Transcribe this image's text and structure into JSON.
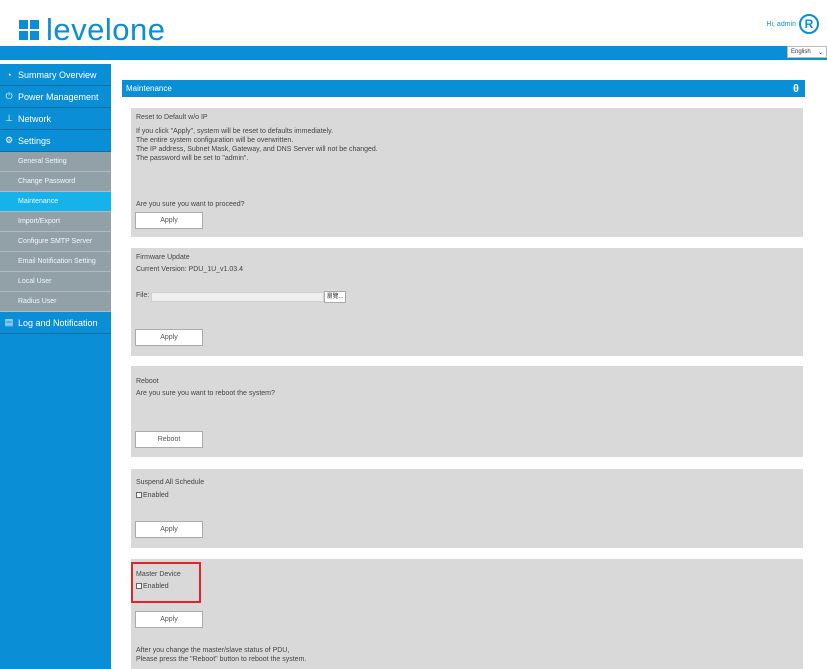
{
  "header": {
    "logo_text": "levelone",
    "greeting": "Hi, admin",
    "user_icon_letter": "R",
    "language": "English"
  },
  "sidebar": {
    "items": [
      {
        "label": "Summary Overview",
        "icon": "summary-icon"
      },
      {
        "label": "Power Management",
        "icon": "power-icon"
      },
      {
        "label": "Network",
        "icon": "network-icon"
      },
      {
        "label": "Settings",
        "icon": "gear-icon"
      },
      {
        "label": "Log and Notification",
        "icon": "log-icon"
      }
    ],
    "settings_sub": [
      {
        "label": "General Setting"
      },
      {
        "label": "Change Password"
      },
      {
        "label": "Maintenance"
      },
      {
        "label": "Import/Export"
      },
      {
        "label": "Configure SMTP Server"
      },
      {
        "label": "Email Notification Setting"
      },
      {
        "label": "Local User"
      },
      {
        "label": "Radius User"
      }
    ]
  },
  "main": {
    "title": "Maintenance",
    "reset": {
      "title": "Reset to Default w/o IP",
      "lines": [
        "If you click \"Apply\", system will be reset to defaults immediately.",
        "The entire system configuration will be overwritten.",
        "The IP address, Subnet Mask, Gateway, and DNS Server will not be changed.",
        "The password will be set to \"admin\"."
      ],
      "question": "Are you sure you want to proceed?",
      "button": "Apply"
    },
    "firmware": {
      "title": "Firmware Update",
      "current_version": "Current Version: PDU_1U_v1.03.4",
      "file_label": "File:",
      "browse": "瀏覽...",
      "button": "Apply"
    },
    "reboot": {
      "title": "Reboot",
      "question": "Are you sure you want to reboot the system?",
      "button": "Reboot"
    },
    "suspend": {
      "title": "Suspend All Schedule",
      "checkbox": "Enabled",
      "button": "Apply"
    },
    "master": {
      "title": "Master Device",
      "checkbox": "Enabled",
      "button": "Apply",
      "note1": "After you change the master/slave status of PDU,",
      "note2": "Please press the \"Reboot\" button to reboot the system."
    }
  }
}
